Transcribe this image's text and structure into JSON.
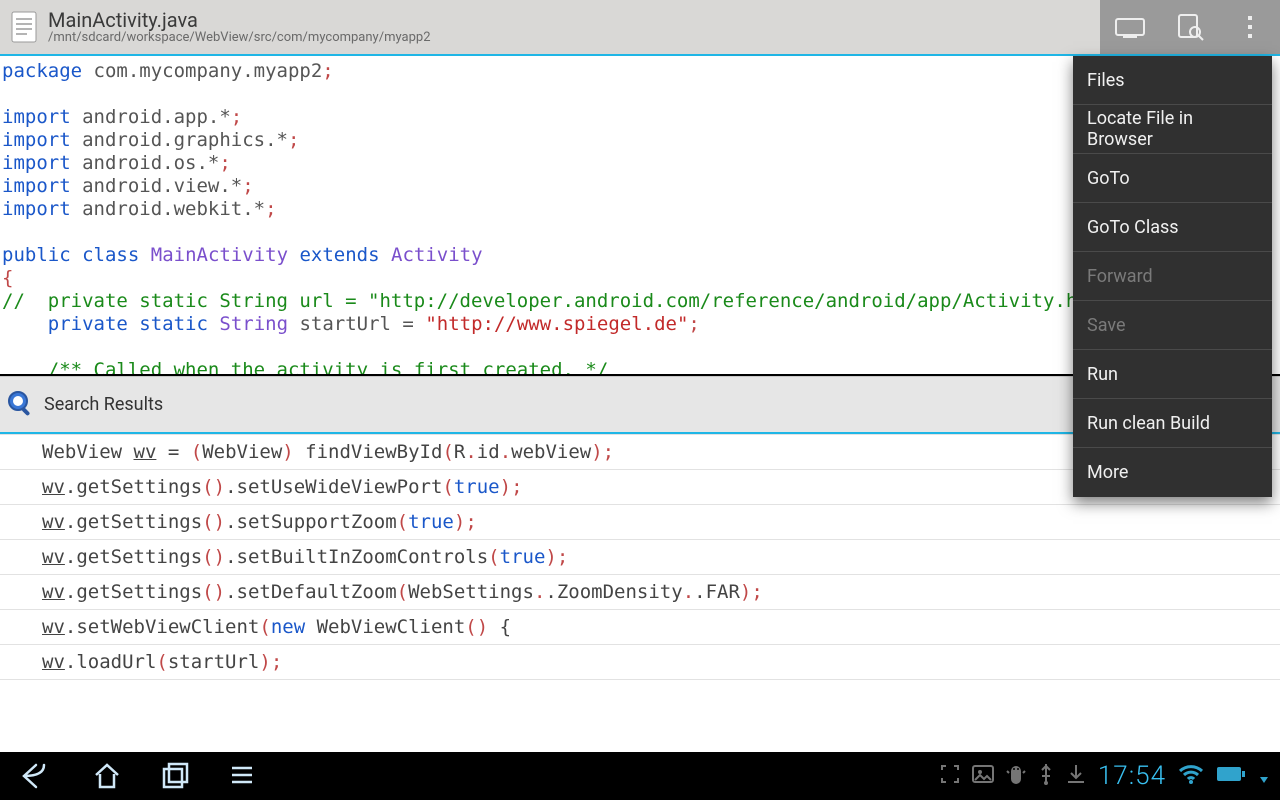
{
  "appbar": {
    "title": "MainActivity.java",
    "subtitle": "/mnt/sdcard/workspace/WebView/src/com/mycompany/myapp2"
  },
  "code": {
    "package_kw": "package",
    "package_name": " com.mycompany.myapp2",
    "import_kw": "import",
    "import1": " android.app.*",
    "import2": " android.graphics.*",
    "import3": " android.os.*",
    "import4": " android.view.*",
    "import5": " android.webkit.*",
    "public_kw": "public",
    "class_kw": "class",
    "class_name": "MainActivity",
    "extends_kw": "extends",
    "super_name": "Activity",
    "brace_open": "{",
    "line_comment": "//  private static String url = \"http://developer.android.com/reference/android/app/Activity.html",
    "private_kw": "private",
    "static_kw": "static",
    "string_type": "String",
    "starturl_var": " startUrl = ",
    "starturl_val": "\"http://www.spiegel.de\"",
    "doc_comment": "/** Called when the activity is first created. */",
    "semicolon": ";"
  },
  "search": {
    "label": "Search Results"
  },
  "results": {
    "r0_a": "WebView ",
    "r0_u": "wv",
    "r0_b": " = ",
    "r0_p1": "(",
    "r0_c": "WebView",
    "r0_p2": ")",
    "r0_d": " findViewById",
    "r0_p3": "(",
    "r0_e": "R",
    "r0_dot": ".",
    "r0_f": "id",
    "r0_g": "webView",
    "r0_p4": ")",
    "r0_semi": ";",
    "r1_u": "wv",
    "r1_a": ".getSettings",
    "r1_p1": "()",
    "r1_b": ".setUseWideViewPort",
    "r1_p2": "(",
    "r1_kw": "true",
    "r1_p3": ")",
    "r1_semi": ";",
    "r2_u": "wv",
    "r2_a": ".getSettings",
    "r2_p1": "()",
    "r2_b": ".setSupportZoom",
    "r2_p2": "(",
    "r2_kw": "true",
    "r2_p3": ")",
    "r2_semi": ";",
    "r3_u": "wv",
    "r3_a": ".getSettings",
    "r3_p1": "()",
    "r3_b": ".setBuiltInZoomControls",
    "r3_p2": "(",
    "r3_kw": "true",
    "r3_p3": ")",
    "r3_semi": ";",
    "r4_u": "wv",
    "r4_a": ".getSettings",
    "r4_p1": "()",
    "r4_b": ".setDefaultZoom",
    "r4_p2": "(",
    "r4_c": "WebSettings",
    "r4_d": ".ZoomDensity",
    "r4_e": ".FAR",
    "r4_p3": ")",
    "r4_semi": ";",
    "r5_u": "wv",
    "r5_a": ".setWebViewClient",
    "r5_p1": "(",
    "r5_kw": "new",
    "r5_b": " WebViewClient",
    "r5_p2": "()",
    "r5_c": " {",
    "r6_u": "wv",
    "r6_a": ".loadUrl",
    "r6_p1": "(",
    "r6_b": "startUrl",
    "r6_p2": ")",
    "r6_semi": ";"
  },
  "menu": {
    "items": [
      {
        "label": "Files",
        "enabled": true
      },
      {
        "label": "Locate File in Browser",
        "enabled": true
      },
      {
        "label": "GoTo",
        "enabled": true
      },
      {
        "label": "GoTo Class",
        "enabled": true
      },
      {
        "label": "Forward",
        "enabled": false
      },
      {
        "label": "Save",
        "enabled": false
      },
      {
        "label": "Run",
        "enabled": true
      },
      {
        "label": "Run clean Build",
        "enabled": true
      },
      {
        "label": "More",
        "enabled": true
      }
    ]
  },
  "navbar": {
    "clock": "17:54"
  }
}
